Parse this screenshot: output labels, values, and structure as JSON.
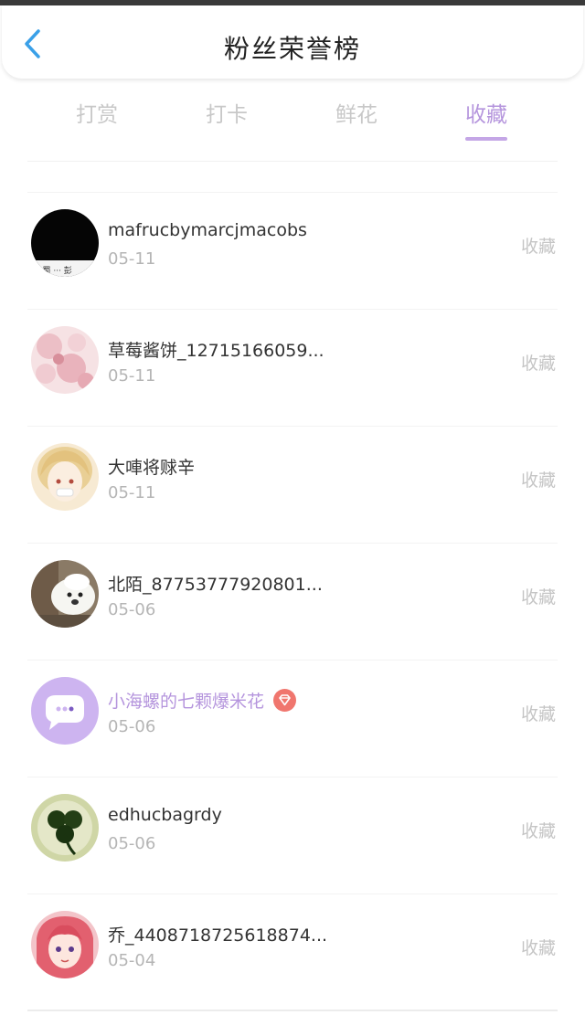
{
  "header": {
    "title": "粉丝荣誉榜",
    "back_icon": "chevron-left-icon",
    "accent_color": "#3aa0e8"
  },
  "tabs": [
    {
      "label": "打赏",
      "active": false
    },
    {
      "label": "打卡",
      "active": false
    },
    {
      "label": "鲜花",
      "active": false
    },
    {
      "label": "收藏",
      "active": true
    }
  ],
  "active_color": "#b595dd",
  "rows": [
    {
      "name": "mafrucbymarcjmacobs",
      "date": "05-11",
      "action": "收藏",
      "avatar": "avatar-black",
      "vip": false
    },
    {
      "name": "草莓酱饼_12715166059...",
      "date": "05-11",
      "action": "收藏",
      "avatar": "avatar-pink-floral",
      "vip": false
    },
    {
      "name": "大唓将赇辛",
      "date": "05-11",
      "action": "收藏",
      "avatar": "avatar-anime-blonde",
      "vip": false
    },
    {
      "name": "北陌_87753777920801...",
      "date": "05-06",
      "action": "收藏",
      "avatar": "avatar-bear",
      "vip": false
    },
    {
      "name": "小海螺的七颗爆米花",
      "date": "05-06",
      "action": "收藏",
      "avatar": "avatar-chat-bubble",
      "vip": true,
      "badge_icon": "diamond-badge-icon"
    },
    {
      "name": "edhucbagrdy",
      "date": "05-06",
      "action": "收藏",
      "avatar": "avatar-clover",
      "vip": false
    },
    {
      "name": "乔_4408718725618874...",
      "date": "05-04",
      "action": "收藏",
      "avatar": "avatar-anime-pink",
      "vip": false
    }
  ]
}
